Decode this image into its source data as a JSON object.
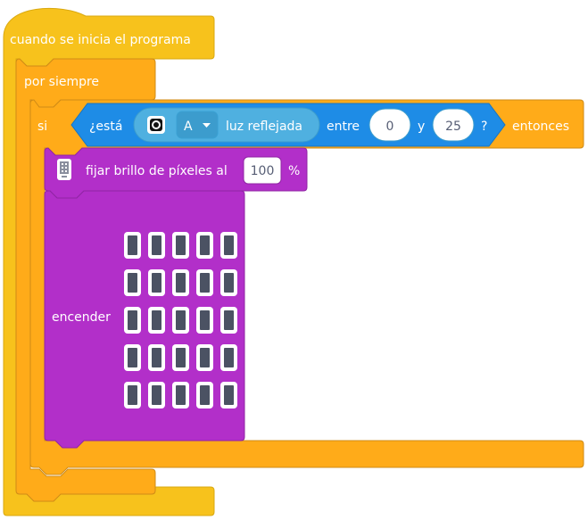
{
  "hat_block": {
    "label": "cuando se inicia el programa",
    "color": "#f7c21c",
    "stroke": "#d9a80f"
  },
  "forever_block": {
    "label": "por siempre",
    "color": "#ffab19",
    "stroke": "#cf8b17"
  },
  "if_block": {
    "label_if": "si",
    "label_then": "entonces",
    "color": "#ffab19"
  },
  "sensor_reporter": {
    "label_prefix": "¿está",
    "icon": "color-sensor-icon",
    "port_value": "A",
    "mode_label": "luz reflejada",
    "label_between": "entre",
    "min_value": "0",
    "label_and": "y",
    "max_value": "25",
    "label_question": "?",
    "color": "#1e8ce6",
    "inner_color": "#4fb0e0"
  },
  "brightness_block": {
    "icon": "matrix-device-icon",
    "label": "fijar brillo de píxeles al",
    "value": "100",
    "unit": "%",
    "color": "#b22fc9"
  },
  "light_block": {
    "label": "encender",
    "color": "#b22fc9",
    "matrix_rows": 5,
    "matrix_cols": 5,
    "pixels_on": []
  }
}
